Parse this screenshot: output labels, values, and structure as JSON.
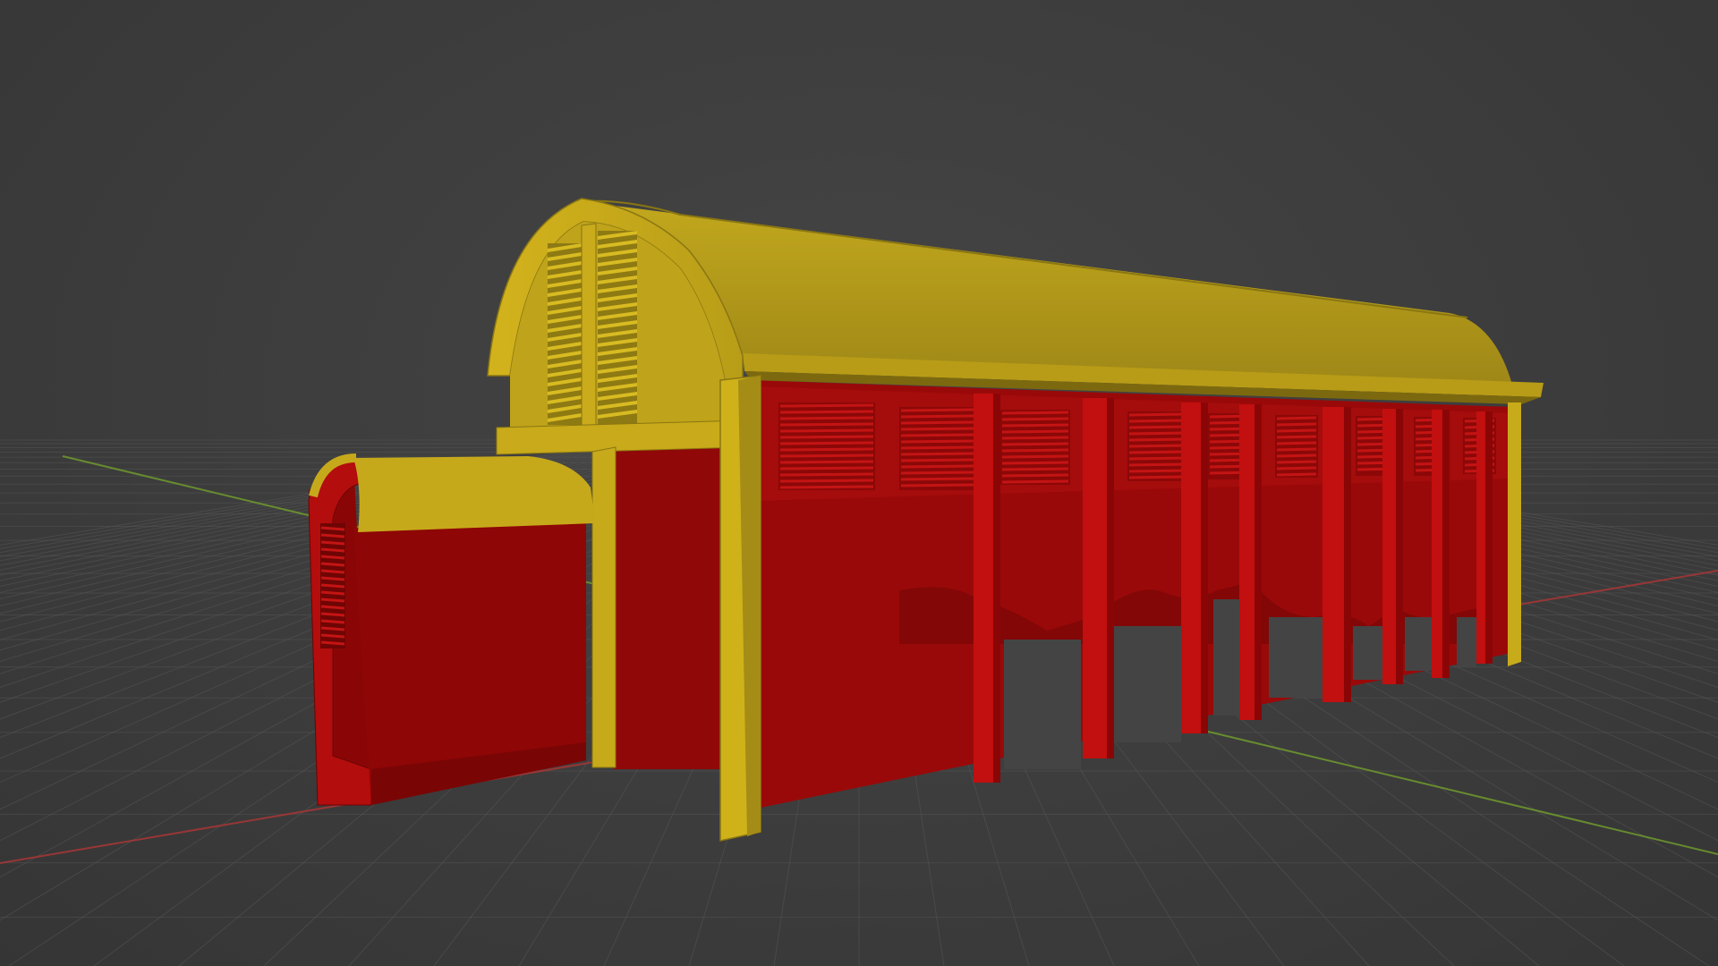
{
  "viewport": {
    "view_type": "3D viewport",
    "background_color": "#3d3d3d",
    "grid_color": "#555555",
    "x_axis_color": "#b03434",
    "y_axis_color": "#6c9b2a"
  },
  "model": {
    "objects": [
      {
        "name": "roof",
        "color": "#c9ae1c"
      },
      {
        "name": "frame",
        "color": "#cdb018"
      },
      {
        "name": "walls",
        "color": "#9c0a0a"
      },
      {
        "name": "louvers",
        "color": "#b50f0f"
      },
      {
        "name": "annex",
        "color": "#8e0707"
      }
    ]
  }
}
